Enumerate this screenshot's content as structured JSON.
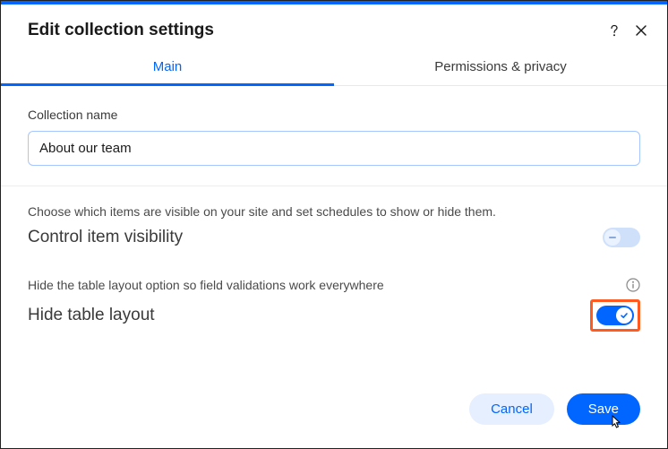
{
  "header": {
    "title": "Edit collection settings"
  },
  "tabs": {
    "main": "Main",
    "permissions": "Permissions & privacy"
  },
  "name_section": {
    "label": "Collection name",
    "value": "About our team"
  },
  "visibility_section": {
    "helper": "Choose which items are visible on your site and set schedules to show or hide them.",
    "title": "Control item visibility",
    "toggle_on": false
  },
  "hide_layout_section": {
    "helper": "Hide the table layout option so field validations work everywhere",
    "title": "Hide table layout",
    "toggle_on": true
  },
  "footer": {
    "cancel": "Cancel",
    "save": "Save"
  }
}
